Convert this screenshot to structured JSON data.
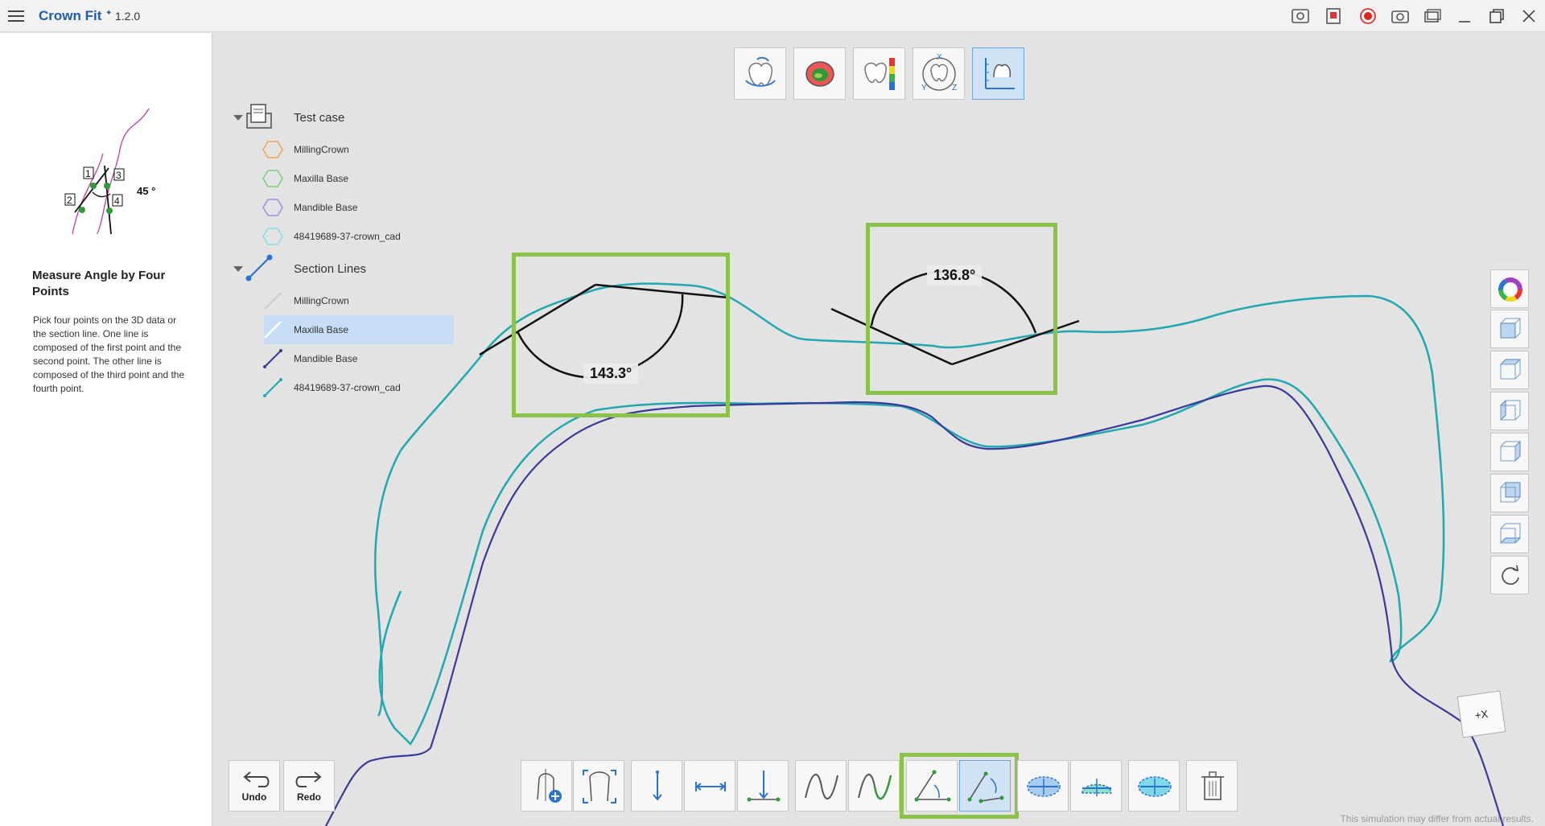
{
  "app": {
    "title": "Crown Fit",
    "version": "1.2.0"
  },
  "help": {
    "title": "Measure Angle by Four Points",
    "text": "Pick four points on the 3D data or the section line. One line is composed of the first point and the second point. The other line is composed of the third point and the fourth point.",
    "diagram_angle": "45 °",
    "diagram_points": [
      "1",
      "2",
      "3",
      "4"
    ]
  },
  "tree": {
    "group1": {
      "label": "Test case",
      "items": [
        {
          "label": "MillingCrown",
          "color": "#f4a55a"
        },
        {
          "label": "Maxilla Base",
          "color": "#7ed07e"
        },
        {
          "label": "Mandible Base",
          "color": "#9a95e0"
        },
        {
          "label": "48419689-37-crown_cad",
          "color": "#7fe0e6"
        }
      ]
    },
    "group2": {
      "label": "Section Lines",
      "items": [
        {
          "label": "MillingCrown",
          "color": "#ffffff"
        },
        {
          "label": "Maxilla Base",
          "color": "#ffffff",
          "selected": true
        },
        {
          "label": "Mandible Base",
          "color": "#3a3a9a"
        },
        {
          "label": "48419689-37-crown_cad",
          "color": "#22a8b0"
        }
      ]
    }
  },
  "measurements": {
    "angle1": "143.3°",
    "angle2": "136.8°"
  },
  "bottom_toolbar": {
    "undo": "Undo",
    "redo": "Redo"
  },
  "orientation_cube": "+X",
  "footer_note": "This simulation may differ from actual results.",
  "colors": {
    "accent": "#1e5fa8",
    "highlight": "#8bc34a",
    "section_crown": "#22a8b0",
    "section_mandible": "#3a3a9a",
    "selection": "#c6ddf5"
  }
}
